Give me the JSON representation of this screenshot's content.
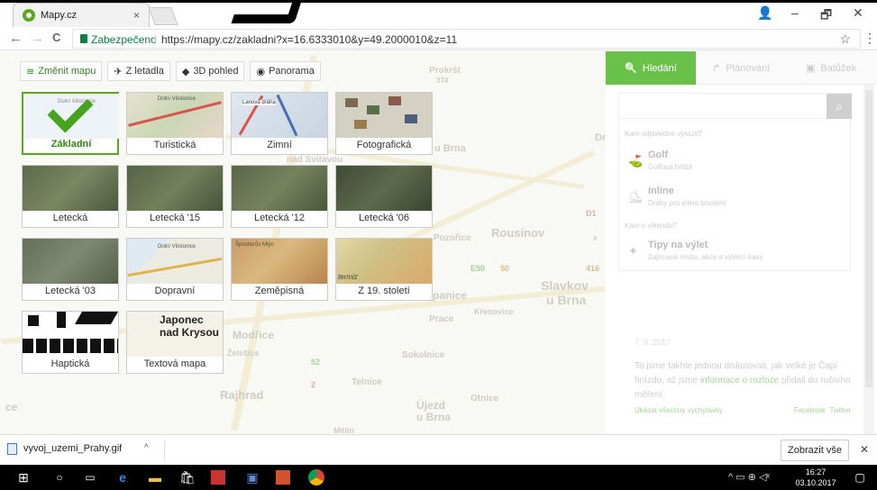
{
  "browser": {
    "tab_title": "Mapy.cz",
    "tab_close": "×",
    "secure_label": "Zabezpečeno",
    "url": "https://mapy.cz/zakladni?x=16.6333010&y=49.2000010&z=11",
    "back": "←",
    "forward": "→",
    "reload": "C",
    "star": "☆",
    "menu": "⋮",
    "account": "👤",
    "minimize": "–",
    "restore": "🗗",
    "close": "✕"
  },
  "toolbar": {
    "change_map": "Změnit mapu",
    "from_plane": "Z letadla",
    "view3d": "3D pohled",
    "panorama": "Panorama"
  },
  "map_types": [
    {
      "label": "Základní",
      "selected": true
    },
    {
      "label": "Turistická"
    },
    {
      "label": "Zimní"
    },
    {
      "label": "Fotografická"
    },
    {
      "label": "Letecká"
    },
    {
      "label": "Letecká '15"
    },
    {
      "label": "Letecká '12"
    },
    {
      "label": "Letecká '06"
    },
    {
      "label": "Letecká '03"
    },
    {
      "label": "Dopravní"
    },
    {
      "label": "Zeměpisná"
    },
    {
      "label": "Z 19. století"
    },
    {
      "label": "Haptická"
    },
    {
      "label": "Textová mapa"
    }
  ],
  "thumb_text": {
    "zakladni": "Dolní Věstonice",
    "turisticka": "Dolní Věstonice",
    "zimni": "Lanová dráha",
    "dopravni": "Dolní Věstonice",
    "zemepisna": "Špindlerův Mlýn",
    "z19": "termiz",
    "textova_line1": "Japonec",
    "textova_line2": "nad Krysou"
  },
  "map_labels": {
    "prokrst": "Prokršt",
    "b374": "374",
    "uzbrna": "u Brna",
    "rousinov": "Rousínov",
    "slavkov1": "Slavkov",
    "slavkov2": "u Brna",
    "pozorice": "Pozořice",
    "modrice": "Modřice",
    "zelesice": "Želešice",
    "sokolnice": "Sokolnice",
    "telnice": "Telnice",
    "rajhrad": "Rajhrad",
    "ujezd1": "Újezd",
    "ujezd2": "u Brna",
    "otnice": "Otnice",
    "prace": "Prace",
    "krenovice": "Křenovice",
    "panice": "panice",
    "melin": "Mělín",
    "ce": "ce",
    "sdvorec": "nad Svitavou",
    "dr": "Dr",
    "d1": "D1",
    "e50": "E50",
    "c50": "50",
    "c416": "416",
    "c52": "52",
    "c2": "2"
  },
  "panel": {
    "tab_search": "Hledání",
    "tab_plan": "Plánování",
    "tab_trip": "Batůžek",
    "search_icon": "🔍",
    "q1": "Kam odpoledne vyrazit?",
    "item1_title": "Golf",
    "item1_sub": "Golfová hřiště",
    "item2_title": "Inline",
    "item2_sub": "Dráhy pro inline bruslení",
    "q2": "Kam o víkendu?",
    "item3_title": "Tipy na výlet",
    "item3_sub": "Zajímavá místa, akce a výletní trasy",
    "news_date": "7. 9. 2017",
    "news_text1": "To jsme takhle jednou diskutovali, jak velké je Čapí hnízdo, až jsme ",
    "news_link": "informace o rozloze",
    "news_text2": " přidali do ručního měření.",
    "show_all": "Ukázat všechny vychytávky",
    "facebook": "Facebook",
    "twitter": "Twitter",
    "collapse": "›"
  },
  "download": {
    "file": "vyvoj_uzemi_Prahy.gif",
    "caret": "^",
    "show_all": "Zobrazit vše",
    "close": "✕"
  },
  "taskbar": {
    "time": "16:27",
    "date": "03.10.2017",
    "tray": "^ ▭ ⊕ ◁ˣ"
  },
  "colors": {
    "accent": "#6ac14a",
    "selected": "#5ba820"
  }
}
